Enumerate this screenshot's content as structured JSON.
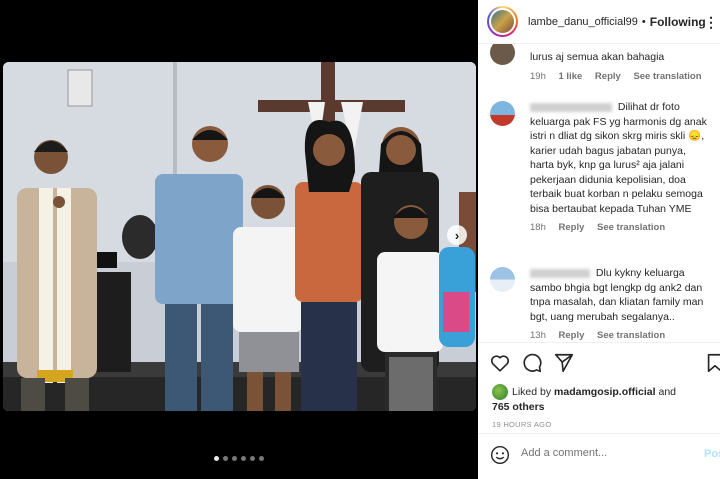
{
  "post": {
    "username": "lambe_danu_official99",
    "separator": "•",
    "follow_label": "Following",
    "more_icon": "more-horizontal-icon"
  },
  "comments": [
    {
      "text": "lurus aj semua akan bahagia",
      "time": "19h",
      "likes": "1 like",
      "reply": "Reply",
      "translate": "See translation"
    },
    {
      "text": "Dilihat dr foto keluarga pak FS yg harmonis dg anak istri n dliat dg sikon skrg miris skli 😞, karier udah bagus jabatan punya, harta byk, knp ga lurus² aja jalani pekerjaan didunia kepolisian, doa terbaik buat korban n pelaku semoga bisa bertaubat kepada Tuhan YME",
      "time": "18h",
      "reply": "Reply",
      "translate": "See translation"
    },
    {
      "text": "Dlu kykny keluarga sambo bhgia bgt lengkp dg ank2 dan tnpa masalah, dan kliatan family man bgt, uang merubah segalanya..",
      "time": "13h",
      "reply": "Reply",
      "translate": "See translation"
    }
  ],
  "actions": {
    "like_icon": "heart-icon",
    "comment_icon": "comment-icon",
    "share_icon": "share-icon",
    "save_icon": "bookmark-icon"
  },
  "likes": {
    "prefix": "Liked by",
    "user": "madamgosip.official",
    "and": "and",
    "others": "765 others"
  },
  "time_ago": "19 HOURS AGO",
  "add_comment": {
    "placeholder": "Add a comment...",
    "post_label": "Post"
  },
  "carousel": {
    "count": 6,
    "active_index": 0
  }
}
